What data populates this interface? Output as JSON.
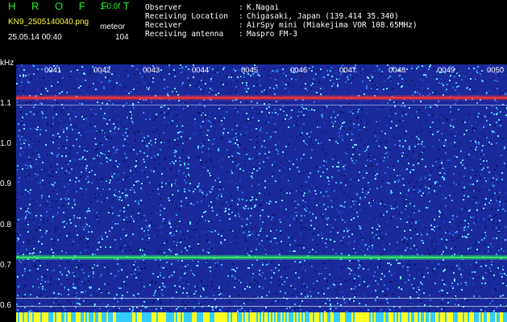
{
  "header": {
    "app_title": "H R O F F T",
    "app_version": "1.0.0f",
    "file_name": "KN9_2505140040.png",
    "mode": "meteor",
    "timestamp": "25.05.14 00:40",
    "count": "104"
  },
  "meta": [
    {
      "key": "Observer",
      "value": "K.Nagai"
    },
    {
      "key": "Receiving Location",
      "value": "Chigasaki, Japan (139.414 35.340)"
    },
    {
      "key": "Receiver",
      "value": "AirSpy mini (Miakejima VOR 108.65MHz)"
    },
    {
      "key": "Receiving antenna",
      "value": "Maspro FM-3"
    }
  ],
  "meta_sep": ":",
  "chart_data": {
    "type": "heatmap",
    "ylabel": "kHz",
    "y_ticks": [
      "1.1",
      "1.0",
      "0.9",
      "0.8",
      "0.7",
      "0.6"
    ],
    "x_ticks": [
      "0041",
      "0042",
      "0043",
      "0044",
      "0045",
      "0046",
      "0047",
      "0048",
      "0049",
      "0050"
    ],
    "bands": [
      {
        "freq_khz": 1.115,
        "color": "#ff3333"
      },
      {
        "freq_khz": 0.72,
        "color": "#33ee66"
      }
    ]
  },
  "colors": {
    "background": "#000000",
    "waterfall_base": "#1a2a9c",
    "noise": "#3fa0ff",
    "title": "#22ee22",
    "file": "#ffff33"
  }
}
